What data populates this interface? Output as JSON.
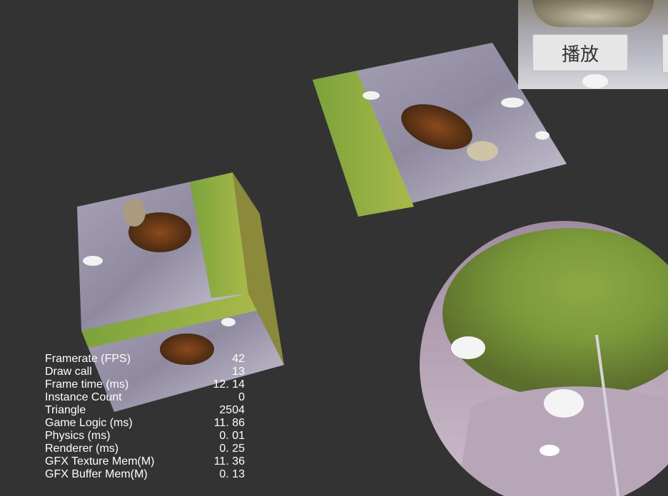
{
  "ui_panel": {
    "play_label": "播放"
  },
  "stats": [
    {
      "label": "Framerate (FPS)",
      "value": "42"
    },
    {
      "label": "Draw call",
      "value": "13"
    },
    {
      "label": "Frame time (ms)",
      "value": "12. 14"
    },
    {
      "label": "Instance Count",
      "value": "0"
    },
    {
      "label": "Triangle",
      "value": "2504"
    },
    {
      "label": "Game Logic (ms)",
      "value": "11. 86"
    },
    {
      "label": "Physics (ms)",
      "value": "0. 01"
    },
    {
      "label": "Renderer (ms)",
      "value": "0. 25"
    },
    {
      "label": "GFX Texture Mem(M)",
      "value": "11. 36"
    },
    {
      "label": "GFX Buffer Mem(M)",
      "value": "0. 13"
    }
  ],
  "colors": {
    "background": "#333333",
    "stats_text": "#ffffff",
    "button_bg": "#e6e6e6"
  }
}
